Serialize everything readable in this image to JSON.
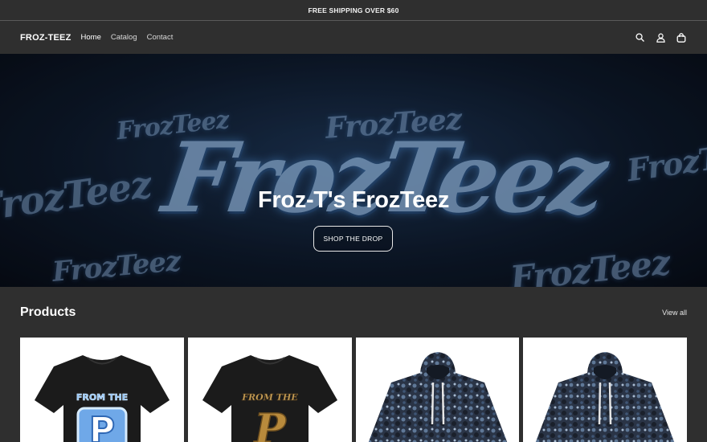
{
  "announcement": "FREE SHIPPING OVER $60",
  "header": {
    "brand": "FROZ-TEEZ",
    "nav": [
      "Home",
      "Catalog",
      "Contact"
    ],
    "icons": [
      "search-icon",
      "account-icon",
      "cart-icon"
    ]
  },
  "hero": {
    "title": "Froz-T's FrozTeez",
    "cta": "SHOP THE DROP",
    "background_word": "FrozTeez"
  },
  "products": {
    "heading": "Products",
    "view_all": "View all",
    "items": [
      {
        "type": "t-shirt",
        "graphic": "blue ice P",
        "print_text": "FROM THE",
        "print_letter": "P"
      },
      {
        "type": "t-shirt",
        "graphic": "gold drip P",
        "print_text": "FROM THE",
        "print_letter": "P"
      },
      {
        "type": "hoodie",
        "pattern": "camo"
      },
      {
        "type": "hoodie",
        "pattern": "camo"
      }
    ]
  },
  "colors": {
    "background": "#2f2f2f",
    "hero_ice": "#9cc4ef"
  }
}
